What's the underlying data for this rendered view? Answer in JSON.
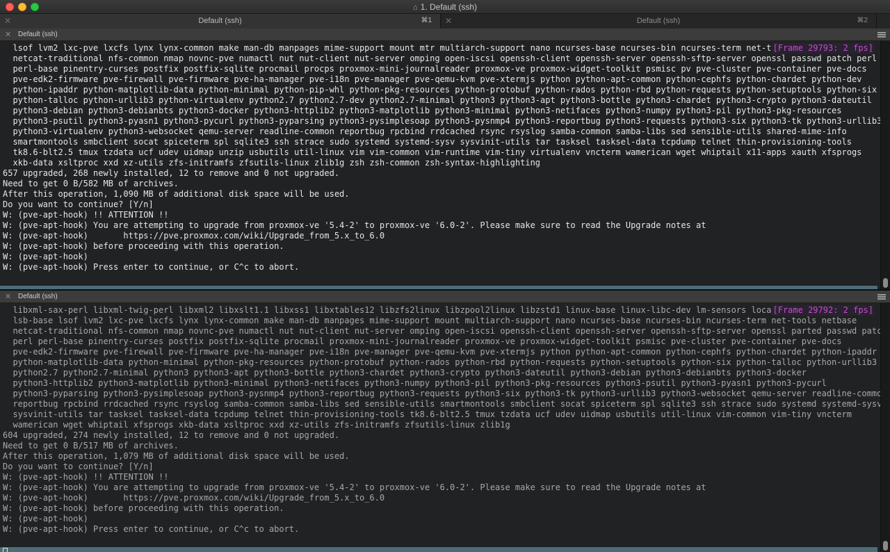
{
  "window": {
    "title": "1. Default (ssh)"
  },
  "tabs": [
    {
      "label": "Default (ssh)",
      "shortcut": "⌘1"
    },
    {
      "label": "Default (ssh)",
      "shortcut": "⌘2"
    }
  ],
  "panes": [
    {
      "header": "Default (ssh)",
      "frame": "[Frame 29793: 2 fps]",
      "lines": [
        "  lsof lvm2 lxc-pve lxcfs lynx lynx-common make man-db manpages mime-support mount mtr multiarch-support nano ncurses-base ncurses-bin ncurses-term net-tool",
        "  netcat-traditional nfs-common nmap novnc-pve numactl nut nut-client nut-server omping open-iscsi openssh-client openssh-server openssh-sftp-server openssl passwd patch perl",
        "  perl-base pinentry-curses postfix postfix-sqlite procmail procps proxmox-mini-journalreader proxmox-ve proxmox-widget-toolkit psmisc pv pve-cluster pve-container pve-docs",
        "  pve-edk2-firmware pve-firewall pve-firmware pve-ha-manager pve-i18n pve-manager pve-qemu-kvm pve-xtermjs python python-apt-common python-cephfs python-chardet python-dev",
        "  python-ipaddr python-matplotlib-data python-minimal python-pip-whl python-pkg-resources python-protobuf python-rados python-rbd python-requests python-setuptools python-six",
        "  python-talloc python-urllib3 python-virtualenv python2.7 python2.7-dev python2.7-minimal python3 python3-apt python3-bottle python3-chardet python3-crypto python3-dateutil",
        "  python3-debian python3-debianbts python3-docker python3-httplib2 python3-matplotlib python3-minimal python3-netifaces python3-numpy python3-pil python3-pkg-resources",
        "  python3-psutil python3-pyasn1 python3-pycurl python3-pyparsing python3-pysimplesoap python3-pysnmp4 python3-reportbug python3-requests python3-six python3-tk python3-urllib3",
        "  python3-virtualenv python3-websocket qemu-server readline-common reportbug rpcbind rrdcached rsync rsyslog samba-common samba-libs sed sensible-utils shared-mime-info",
        "  smartmontools smbclient socat spiceterm spl sqlite3 ssh strace sudo systemd systemd-sysv sysvinit-utils tar tasksel tasksel-data tcpdump telnet thin-provisioning-tools",
        "  tk8.6-blt2.5 tmux tzdata ucf udev uidmap unzip usbutils util-linux vim vim-common vim-runtime vim-tiny virtualenv vncterm wamerican wget whiptail x11-apps xauth xfsprogs",
        "  xkb-data xsltproc xxd xz-utils zfs-initramfs zfsutils-linux zlib1g zsh zsh-common zsh-syntax-highlighting",
        "657 upgraded, 268 newly installed, 12 to remove and 0 not upgraded.",
        "Need to get 0 B/582 MB of archives.",
        "After this operation, 1,090 MB of additional disk space will be used.",
        "Do you want to continue? [Y/n]",
        "W: (pve-apt-hook) !! ATTENTION !!",
        "W: (pve-apt-hook) You are attempting to upgrade from proxmox-ve '5.4-2' to proxmox-ve '6.0-2'. Please make sure to read the Upgrade notes at",
        "W: (pve-apt-hook)       https://pve.proxmox.com/wiki/Upgrade_from_5.x_to_6.0",
        "W: (pve-apt-hook) before proceeding with this operation.",
        "W: (pve-apt-hook)",
        "W: (pve-apt-hook) Press enter to continue, or C^c to abort."
      ]
    },
    {
      "header": "Default (ssh)",
      "frame": "[Frame 29792: 2 fps]",
      "lines": [
        "  libxml-sax-perl libxml-twig-perl libxml2 libxslt1.1 libxss1 libxtables12 libzfs2linux libzpool2linux libzstd1 linux-base linux-libc-dev lm-sensors locales",
        "  lsb-base lsof lvm2 lxc-pve lxcfs lynx lynx-common make man-db manpages mime-support mount multiarch-support nano ncurses-base ncurses-bin ncurses-term net-tools netbase",
        "  netcat-traditional nfs-common nmap novnc-pve numactl nut nut-client nut-server omping open-iscsi openssh-client openssh-server openssh-sftp-server openssl parted passwd patch",
        "  perl perl-base pinentry-curses postfix postfix-sqlite procmail proxmox-mini-journalreader proxmox-ve proxmox-widget-toolkit psmisc pve-cluster pve-container pve-docs",
        "  pve-edk2-firmware pve-firewall pve-firmware pve-ha-manager pve-i18n pve-manager pve-qemu-kvm pve-xtermjs python python-apt-common python-cephfs python-chardet python-ipaddr",
        "  python-matplotlib-data python-minimal python-pkg-resources python-protobuf python-rados python-rbd python-requests python-setuptools python-six python-talloc python-urllib3",
        "  python2.7 python2.7-minimal python3 python3-apt python3-bottle python3-chardet python3-crypto python3-dateutil python3-debian python3-debianbts python3-docker",
        "  python3-httplib2 python3-matplotlib python3-minimal python3-netifaces python3-numpy python3-pil python3-pkg-resources python3-psutil python3-pyasn1 python3-pycurl",
        "  python3-pyparsing python3-pysimplesoap python3-pysnmp4 python3-reportbug python3-requests python3-six python3-tk python3-urllib3 python3-websocket qemu-server readline-common",
        "  reportbug rpcbind rrdcached rsync rsyslog samba-common samba-libs sed sensible-utils smartmontools smbclient socat spiceterm spl sqlite3 ssh strace sudo systemd systemd-sysv",
        "  sysvinit-utils tar tasksel tasksel-data tcpdump telnet thin-provisioning-tools tk8.6-blt2.5 tmux tzdata ucf udev uidmap usbutils util-linux vim-common vim-tiny vncterm",
        "  wamerican wget whiptail xfsprogs xkb-data xsltproc xxd xz-utils zfs-initramfs zfsutils-linux zlib1g",
        "604 upgraded, 274 newly installed, 12 to remove and 0 not upgraded.",
        "Need to get 0 B/517 MB of archives.",
        "After this operation, 1,079 MB of additional disk space will be used.",
        "Do you want to continue? [Y/n]",
        "W: (pve-apt-hook) !! ATTENTION !!",
        "W: (pve-apt-hook) You are attempting to upgrade from proxmox-ve '5.4-2' to proxmox-ve '6.0-2'. Please make sure to read the Upgrade notes at",
        "W: (pve-apt-hook)       https://pve.proxmox.com/wiki/Upgrade_from_5.x_to_6.0",
        "W: (pve-apt-hook) before proceeding with this operation.",
        "W: (pve-apt-hook)",
        "W: (pve-apt-hook) Press enter to continue, or C^c to abort."
      ]
    }
  ]
}
